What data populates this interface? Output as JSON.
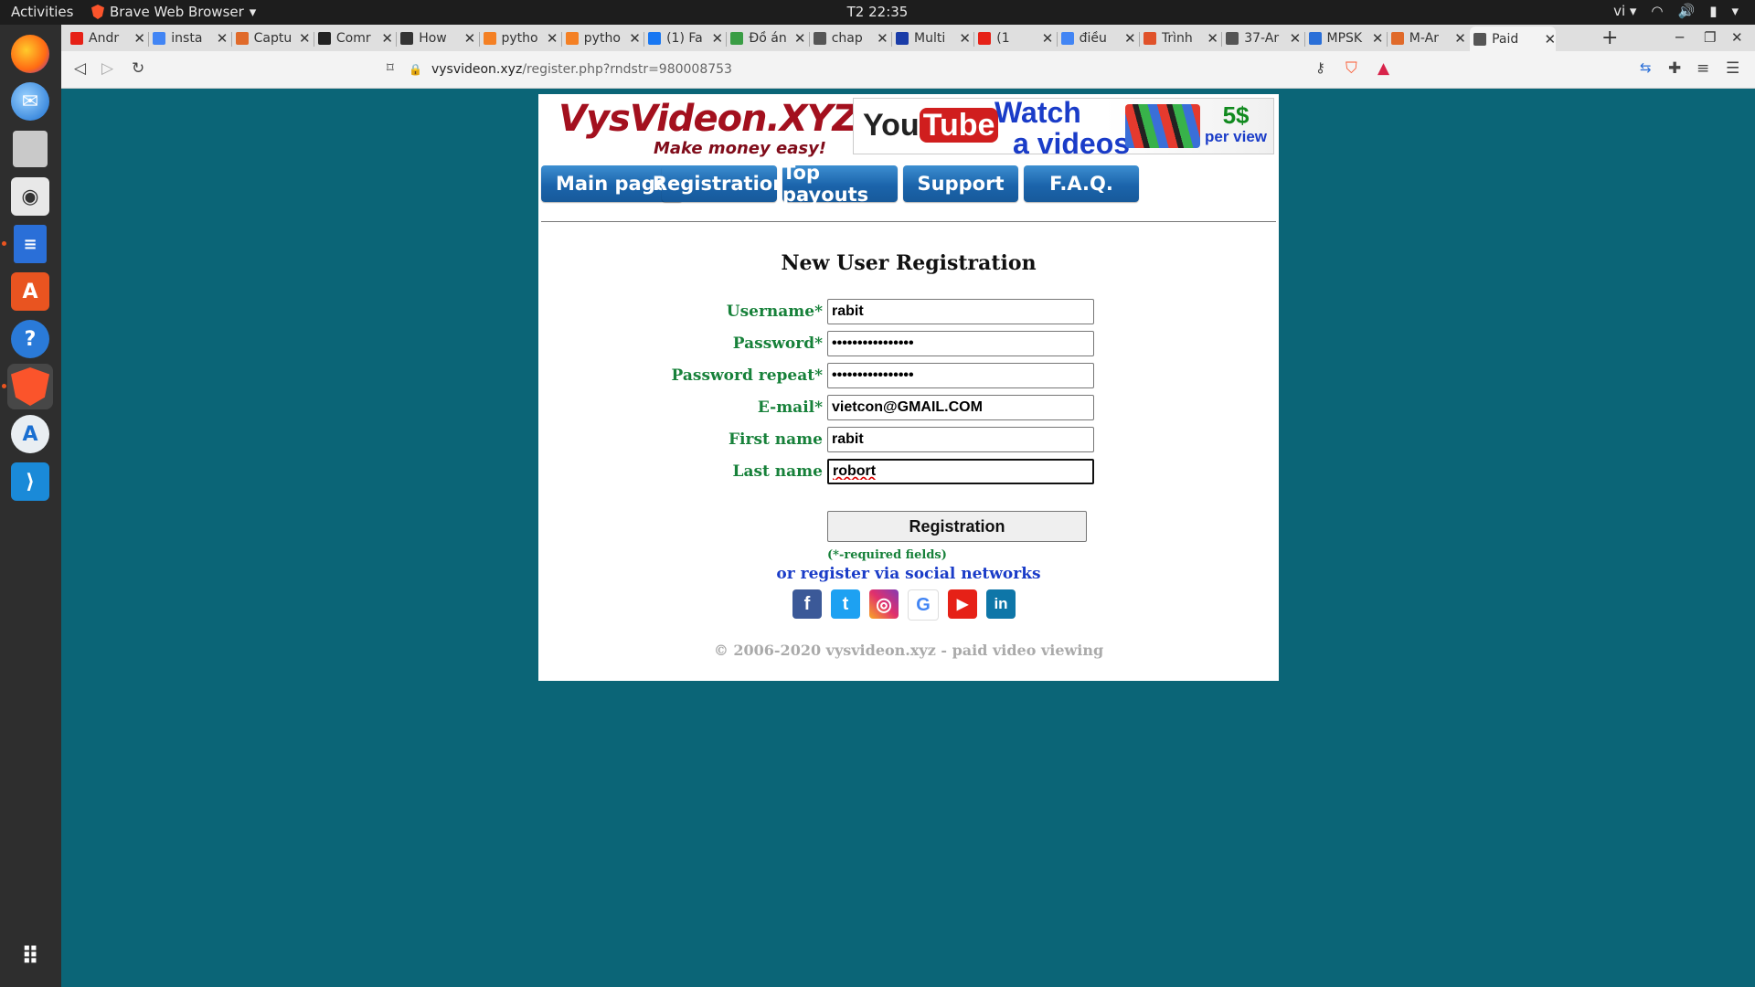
{
  "system": {
    "activities": "Activities",
    "app_name": "Brave Web Browser",
    "clock": "T2 22:35",
    "lang": "vi"
  },
  "dock": {
    "items": [
      "firefox-icon",
      "thunderbird-icon",
      "files-icon",
      "rhythmbox-icon",
      "writer-icon",
      "software-icon",
      "help-icon",
      "brave-icon",
      "android-studio-icon",
      "vscode-icon",
      "app-grid-icon"
    ]
  },
  "tabs": [
    {
      "label": "Andr",
      "color": "#e62117"
    },
    {
      "label": "insta",
      "color": "#4285f4"
    },
    {
      "label": "Captu",
      "color": "#e06a2a"
    },
    {
      "label": "Comr",
      "color": "#222222"
    },
    {
      "label": "How",
      "color": "#333333"
    },
    {
      "label": "pytho",
      "color": "#f48024"
    },
    {
      "label": "pytho",
      "color": "#f48024"
    },
    {
      "label": "(1) Fa",
      "color": "#1877f2"
    },
    {
      "label": "Đồ án",
      "color": "#3a9d45"
    },
    {
      "label": "chap",
      "color": "#555555"
    },
    {
      "label": "Multi",
      "color": "#1a3ca8"
    },
    {
      "label": "(1",
      "color": "#e62117"
    },
    {
      "label": "điều",
      "color": "#4285f4"
    },
    {
      "label": "Trình",
      "color": "#e0522a"
    },
    {
      "label": "37-Ar",
      "color": "#555555"
    },
    {
      "label": "MPSK",
      "color": "#2a6fd8"
    },
    {
      "label": "M-Ar",
      "color": "#e06a2a"
    },
    {
      "label": "Paid",
      "color": "#555555"
    }
  ],
  "url": {
    "host": "vysvideon.xyz",
    "path": "/register.php?rndstr=980008753"
  },
  "page": {
    "logo_title": "VysVideon.XYZ",
    "logo_slogan": "Make money easy!",
    "banner": {
      "you": "You",
      "tube": "Tube",
      "watch_1": "Watch",
      "watch_2": "a videos",
      "amount": "5$",
      "per_view": "per view"
    },
    "nav": [
      "Main page",
      "Registration",
      "Top payouts",
      "Support",
      "F.A.Q."
    ],
    "form_title": "New User Registration",
    "fields": {
      "username": {
        "label": "Username*",
        "value": "rabit"
      },
      "password": {
        "label": "Password*",
        "value": "••••••••••••••••"
      },
      "password_repeat": {
        "label": "Password repeat*",
        "value": "••••••••••••••••"
      },
      "email": {
        "label": "E-mail*",
        "value": "vietcon@GMAIL.COM"
      },
      "first_name": {
        "label": "First name",
        "value": "rabit"
      },
      "last_name": {
        "label": "Last name",
        "value": "robort"
      }
    },
    "submit": "Registration",
    "required_note": "(*-required fields)",
    "social_label": "or register via social networks",
    "social": [
      {
        "name": "facebook",
        "glyph": "f",
        "color": "#3b5998"
      },
      {
        "name": "twitter",
        "glyph": "t",
        "color": "#1da1f2"
      },
      {
        "name": "instagram",
        "glyph": "◎",
        "color": "#c13584"
      },
      {
        "name": "google",
        "glyph": "G",
        "color": "#ffffff"
      },
      {
        "name": "youtube",
        "glyph": "▶",
        "color": "#e62117"
      },
      {
        "name": "linkedin",
        "glyph": "in",
        "color": "#0e76a8"
      }
    ],
    "footer": "© 2006-2020 vysvideon.xyz - paid video viewing"
  }
}
